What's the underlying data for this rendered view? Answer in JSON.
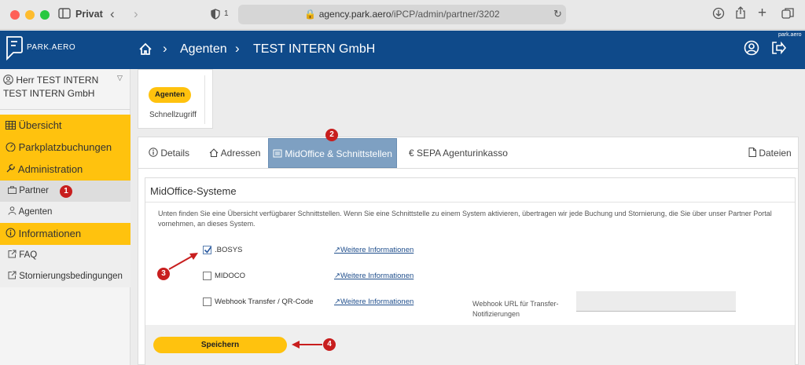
{
  "browser": {
    "private_label": "Privat",
    "tab_count": "1",
    "url_domain": "agency.park.aero",
    "url_path": "/iPCP/admin/partner/3202"
  },
  "brand": {
    "logo_text": "PARK.AERO",
    "corner_text": "park.aero"
  },
  "header": {
    "crumb_section": "Agenten",
    "crumb_entity": "TEST INTERN GmbH"
  },
  "sidebar": {
    "user_name": "Herr TEST INTERN",
    "user_company": "TEST INTERN GmbH",
    "items": [
      {
        "label": "Übersicht"
      },
      {
        "label": "Parkplatzbuchungen"
      },
      {
        "label": "Administration"
      },
      {
        "label": "Partner"
      },
      {
        "label": "Agenten"
      },
      {
        "label": "Informationen"
      },
      {
        "label": "FAQ"
      },
      {
        "label": "Stornierungsbedingungen"
      }
    ]
  },
  "quick": {
    "pill": "Agenten",
    "label": "Schnellzugriff"
  },
  "tabs": [
    {
      "label": "Details"
    },
    {
      "label": "Adressen"
    },
    {
      "label": "MidOffice & Schnittstellen"
    },
    {
      "label": "SEPA Agenturinkasso"
    },
    {
      "label": "Dateien"
    }
  ],
  "panel": {
    "title": "MidOffice-Systeme",
    "description": "Unten finden Sie eine Übersicht verfügbarer Schnittstellen. Wenn Sie eine Schnittstelle zu einem System aktivieren, übertragen wir jede Buchung und Stornierung, die Sie über unser Partner Portal vornehmen, an dieses System.",
    "systems": [
      {
        "label": ".BOSYS",
        "checked": true,
        "link": "Weitere Informationen"
      },
      {
        "label": "MIDOCO",
        "checked": false,
        "link": "Weitere Informationen"
      },
      {
        "label": "Webhook Transfer / QR-Code",
        "checked": false,
        "link": "Weitere Informationen"
      }
    ],
    "webhook_url_label": "Webhook URL für Transfer-Notifizierungen",
    "webhook_url_value": "",
    "save_label": "Speichern"
  },
  "annotations": [
    "1",
    "2",
    "3",
    "4"
  ],
  "colors": {
    "header_blue": "#0f4a8a",
    "accent_yellow": "#ffc20e",
    "active_tab": "#7ea0c2",
    "marker_red": "#c81e1e"
  }
}
